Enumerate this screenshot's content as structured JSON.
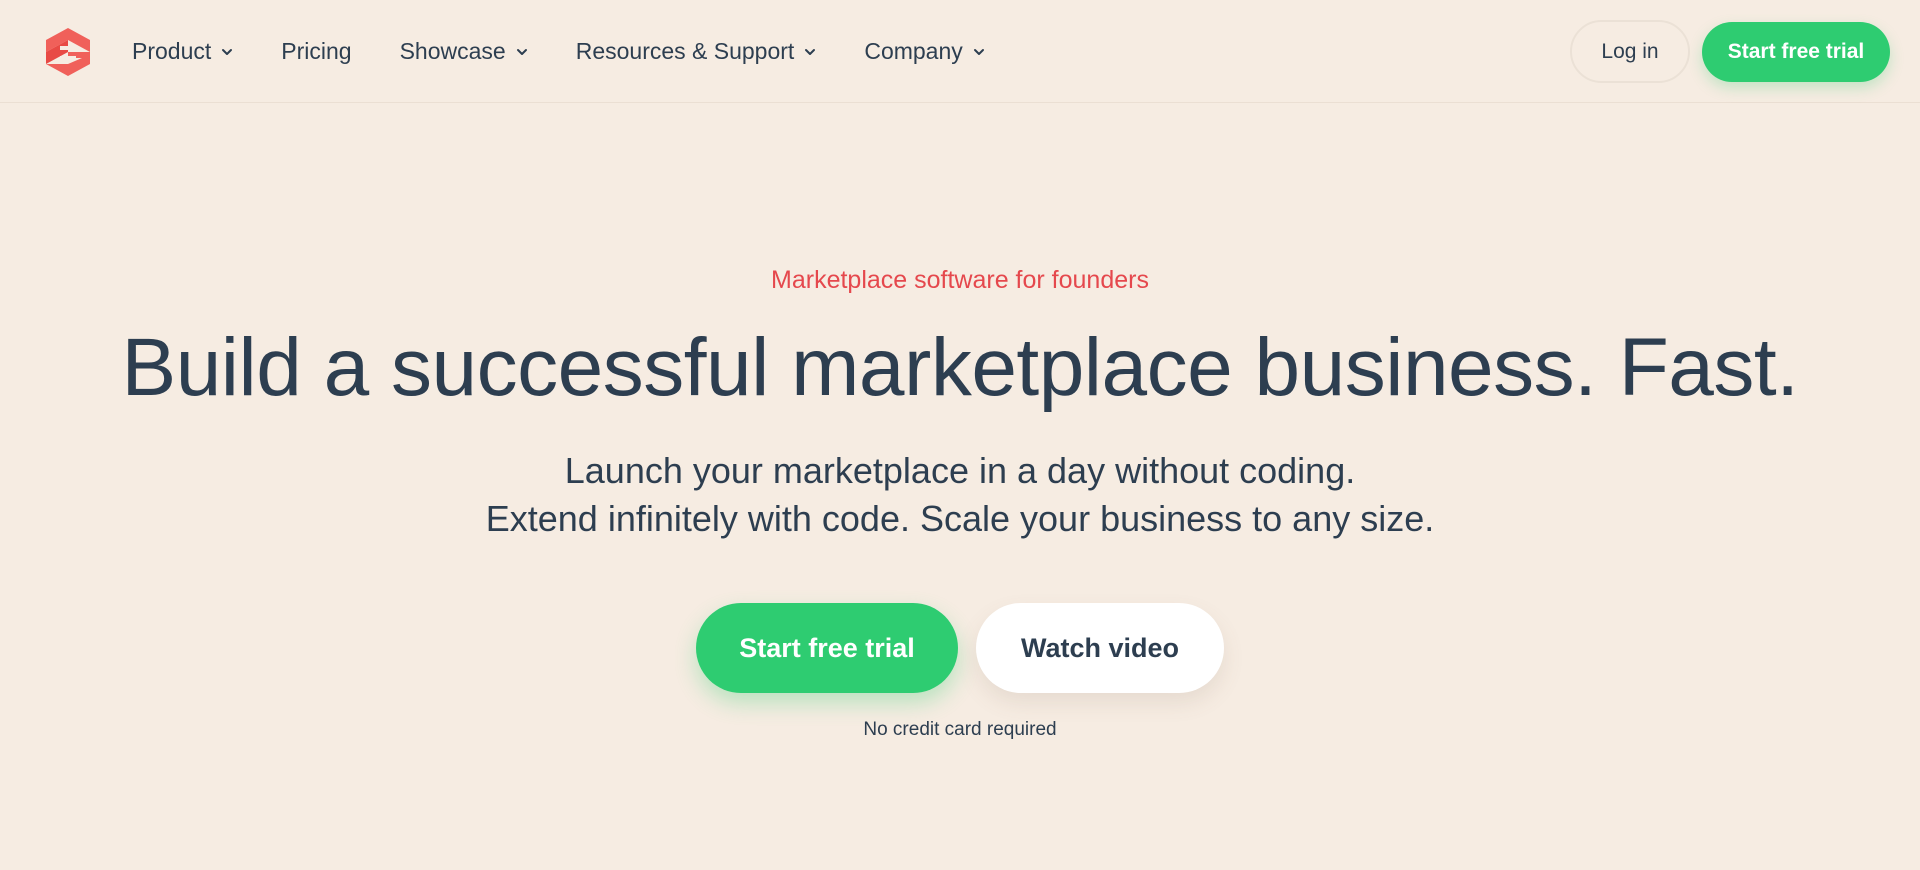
{
  "colors": {
    "background": "#f6ece2",
    "accent_green": "#2ecc71",
    "accent_red": "#e5484d",
    "text_dark": "#2d3e50",
    "logo_red": "#f0605a"
  },
  "header": {
    "logo_icon": "sharetribe-logo-icon",
    "nav": [
      {
        "label": "Product",
        "has_dropdown": true
      },
      {
        "label": "Pricing",
        "has_dropdown": false
      },
      {
        "label": "Showcase",
        "has_dropdown": true
      },
      {
        "label": "Resources & Support",
        "has_dropdown": true
      },
      {
        "label": "Company",
        "has_dropdown": true
      }
    ],
    "login_label": "Log in",
    "trial_label": "Start free trial"
  },
  "hero": {
    "eyebrow": "Marketplace software for founders",
    "headline": "Build a successful marketplace business. Fast.",
    "subline_1": "Launch your marketplace in a day without coding.",
    "subline_2": "Extend infinitely with code. Scale your business to any size.",
    "primary_cta": "Start free trial",
    "secondary_cta": "Watch video",
    "note": "No credit card required"
  }
}
